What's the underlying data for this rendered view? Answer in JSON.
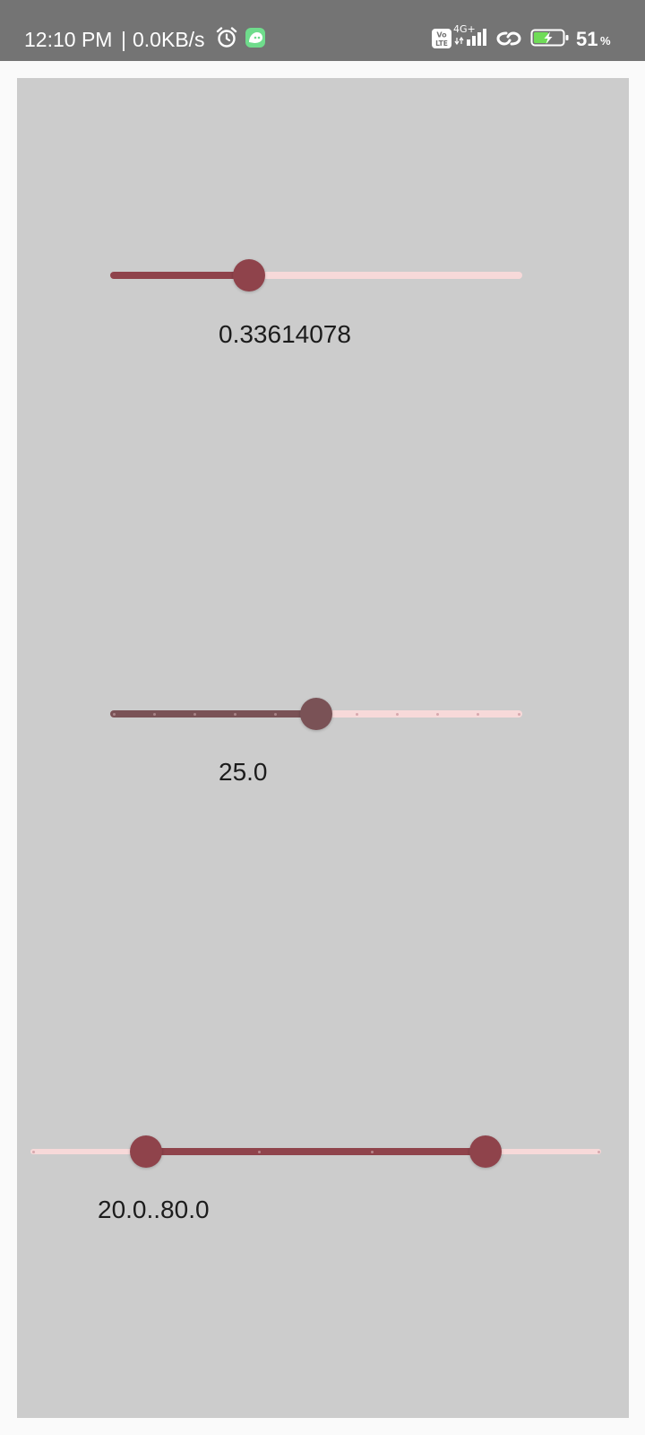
{
  "status_bar": {
    "time": "12:10 PM",
    "separator": "|",
    "network_speed": "0.0KB/s",
    "icons": [
      "alarm-icon",
      "app-notification-icon",
      "volte-icon",
      "4g-signal-icon",
      "link-icon",
      "battery-charging-icon"
    ],
    "network_type": "4G+",
    "volte_label": "Vo LTE",
    "battery_percent": "51",
    "battery_unit": "%"
  },
  "colors": {
    "status_bar": "#747474",
    "panel": "#cccccc",
    "active_track": "#8f434b",
    "inactive_track": "#f7d9d9",
    "disabled_thumb": "#7a5256",
    "tick": "#b98a8f"
  },
  "sliders": {
    "continuous": {
      "value": 0.33614078,
      "min": 0,
      "max": 1,
      "label": "0.33614078"
    },
    "discrete": {
      "value": 25.0,
      "min": 0,
      "max": 50,
      "steps": 10,
      "label": "25.0"
    },
    "range": {
      "start": 20.0,
      "end": 80.0,
      "min": 0,
      "max": 100,
      "steps": 5,
      "label": "20.0..80.0"
    }
  }
}
